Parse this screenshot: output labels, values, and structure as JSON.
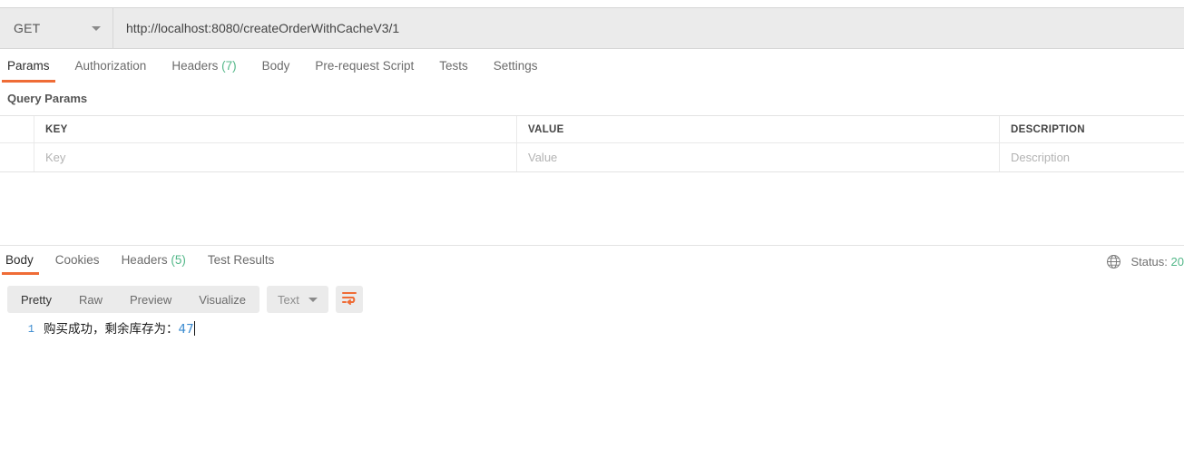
{
  "request": {
    "method": {
      "value": "GET",
      "icon": "chevron-down-icon"
    },
    "url": {
      "value": "http://localhost:8080/createOrderWithCacheV3/1",
      "placeholder": "Enter request URL"
    },
    "tabs": [
      {
        "label": "Params",
        "count": "",
        "active": true
      },
      {
        "label": "Authorization",
        "count": "",
        "active": false
      },
      {
        "label": "Headers",
        "count": "(7)",
        "active": false
      },
      {
        "label": "Body",
        "count": "",
        "active": false
      },
      {
        "label": "Pre-request Script",
        "count": "",
        "active": false
      },
      {
        "label": "Tests",
        "count": "",
        "active": false
      },
      {
        "label": "Settings",
        "count": "",
        "active": false
      }
    ]
  },
  "query_params": {
    "section_title": "Query Params",
    "columns": [
      "KEY",
      "VALUE",
      "DESCRIPTION"
    ],
    "rows": [
      {
        "key": "Key",
        "value": "Value",
        "description": "Description"
      }
    ]
  },
  "response": {
    "tabs": [
      {
        "label": "Body",
        "count": "",
        "active": true
      },
      {
        "label": "Cookies",
        "count": "",
        "active": false
      },
      {
        "label": "Headers",
        "count": "(5)",
        "active": false
      },
      {
        "label": "Test Results",
        "count": "",
        "active": false
      }
    ],
    "status_label": "Status:",
    "status_code": "20",
    "globe_icon": "globe-icon",
    "view_modes": [
      {
        "label": "Pretty",
        "active": true
      },
      {
        "label": "Raw",
        "active": false
      },
      {
        "label": "Preview",
        "active": false
      },
      {
        "label": "Visualize",
        "active": false
      }
    ],
    "format_select": {
      "value": "Text",
      "icon": "chevron-down-icon"
    },
    "wrap_button": {
      "icon": "word-wrap-icon"
    },
    "body": {
      "line_number": "1",
      "text_prefix": "购买成功，剩余库存为：",
      "text_number": "47"
    }
  },
  "colors": {
    "accent": "#ef6c36",
    "count_green": "#52b788",
    "toolbar_bg": "#ebebeb",
    "number_blue": "#3b8bd0"
  }
}
